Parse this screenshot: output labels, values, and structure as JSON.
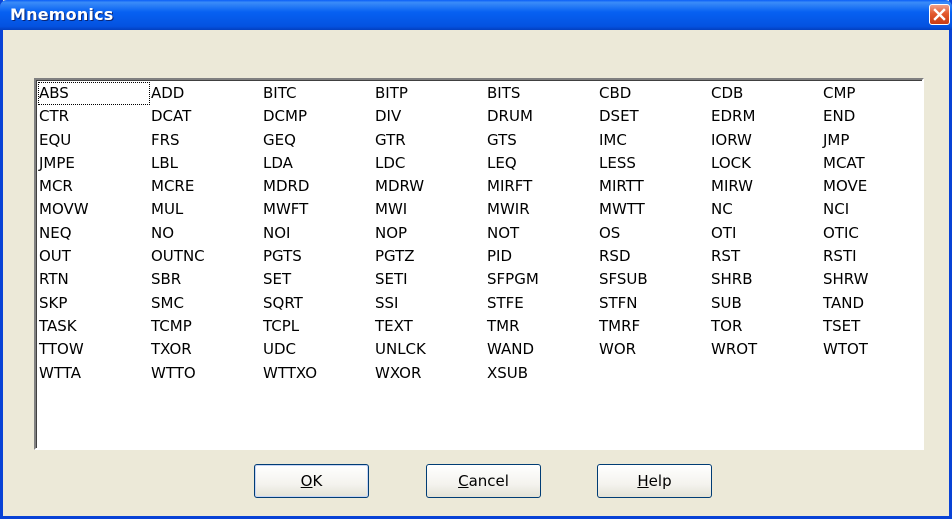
{
  "window": {
    "title": "Mnemonics"
  },
  "list": {
    "items": [
      "ABS",
      "ADD",
      "BITC",
      "BITP",
      "BITS",
      "CBD",
      "CDB",
      "CMP",
      "CTR",
      "DCAT",
      "DCMP",
      "DIV",
      "DRUM",
      "DSET",
      "EDRM",
      "END",
      "EQU",
      "FRS",
      "GEQ",
      "GTR",
      "GTS",
      "IMC",
      "IORW",
      "JMP",
      "JMPE",
      "LBL",
      "LDA",
      "LDC",
      "LEQ",
      "LESS",
      "LOCK",
      "MCAT",
      "MCR",
      "MCRE",
      "MDRD",
      "MDRW",
      "MIRFT",
      "MIRTT",
      "MIRW",
      "MOVE",
      "MOVW",
      "MUL",
      "MWFT",
      "MWI",
      "MWIR",
      "MWTT",
      "NC",
      "NCI",
      "NEQ",
      "NO",
      "NOI",
      "NOP",
      "NOT",
      "OS",
      "OTI",
      "OTIC",
      "OUT",
      "OUTNC",
      "PGTS",
      "PGTZ",
      "PID",
      "RSD",
      "RST",
      "RSTI",
      "RTN",
      "SBR",
      "SET",
      "SETI",
      "SFPGM",
      "SFSUB",
      "SHRB",
      "SHRW",
      "SKP",
      "SMC",
      "SQRT",
      "SSI",
      "STFE",
      "STFN",
      "SUB",
      "TAND",
      "TASK",
      "TCMP",
      "TCPL",
      "TEXT",
      "TMR",
      "TMRF",
      "TOR",
      "TSET",
      "TTOW",
      "TXOR",
      "UDC",
      "UNLCK",
      "WAND",
      "WOR",
      "WROT",
      "WTOT",
      "WTTA",
      "WTTO",
      "WTTXO",
      "WXOR",
      "XSUB"
    ],
    "focused_item": "ABS"
  },
  "buttons": {
    "ok": {
      "mnemonic": "O",
      "rest": "K"
    },
    "cancel": {
      "mnemonic": "C",
      "rest": "ancel"
    },
    "help": {
      "mnemonic": "H",
      "rest": "elp"
    }
  },
  "icons": {
    "close": "close-icon"
  },
  "colors": {
    "titlebar": "#0554e6",
    "close": "#d9441a",
    "face": "#ece9d8"
  }
}
